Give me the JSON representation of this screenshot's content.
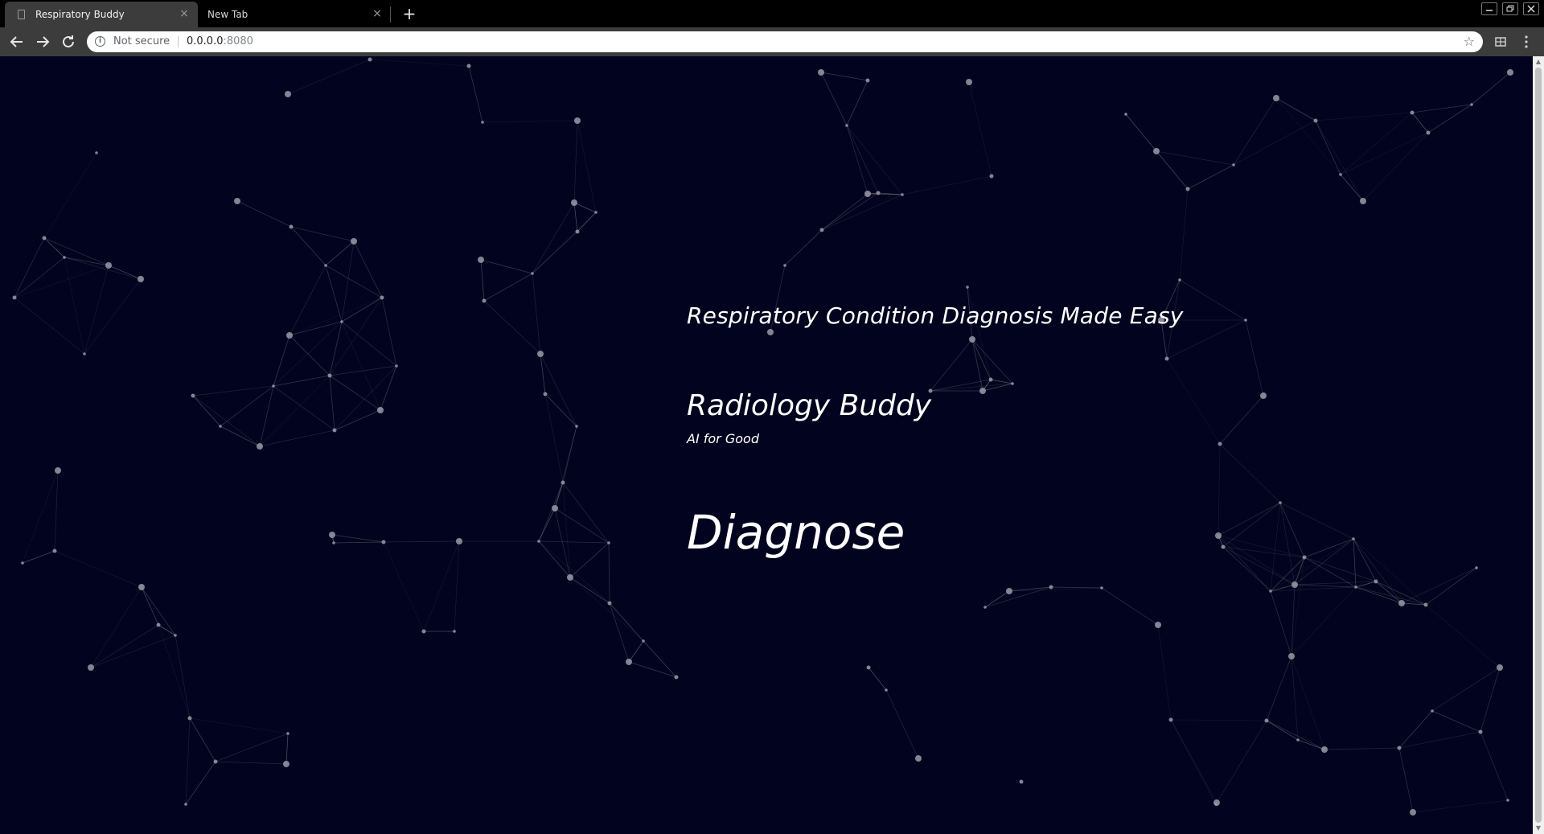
{
  "browser": {
    "tabs": [
      {
        "title": "Respiratory Buddy",
        "active": true
      },
      {
        "title": "New Tab",
        "active": false
      }
    ],
    "new_tab_symbol": "+",
    "close_symbol": "×",
    "security_label": "Not secure",
    "url_host": "0.0.0.0",
    "url_port": ":8080",
    "icons": [
      "back-icon",
      "forward-icon",
      "reload-icon",
      "info-icon",
      "star-icon",
      "extension-icon",
      "menu-icon",
      "minimize-icon",
      "restore-icon",
      "close-window-icon"
    ]
  },
  "page": {
    "tagline": "Respiratory Condition Diagnosis Made Easy",
    "brand": "Radiology Buddy",
    "brand_sub": "AI for Good",
    "cta": "Diagnose"
  },
  "colors": {
    "background": "#02031e",
    "particle": "#9a9aa8",
    "text": "#ffffff"
  }
}
